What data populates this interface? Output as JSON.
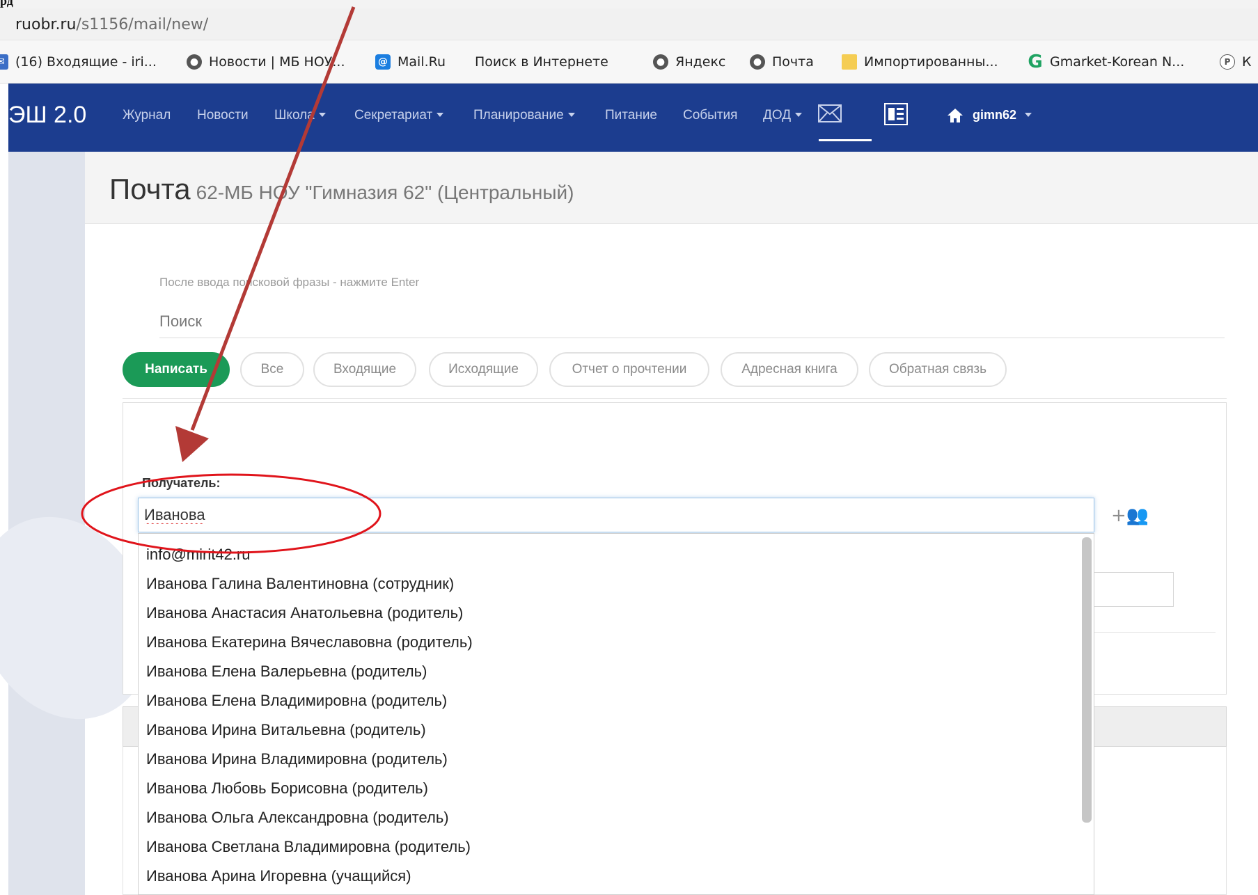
{
  "document": {
    "title_fragment": "рд"
  },
  "browser": {
    "url_host": "ruobr.ru",
    "url_path": "/s1156/mail/new/",
    "bookmarks": [
      {
        "label": "(16) Входящие - iri...",
        "icon": "mail-icon"
      },
      {
        "label": "Новости | МБ НОУ...",
        "icon": "globe-icon"
      },
      {
        "label": "Mail.Ru",
        "icon": "mail-ru-icon"
      },
      {
        "label": "Поиск в Интернете",
        "icon": "search-icon"
      },
      {
        "label": "Яндекс",
        "icon": "globe-icon"
      },
      {
        "label": "Почта",
        "icon": "globe-icon"
      },
      {
        "label": "Импортированны...",
        "icon": "folder-icon"
      },
      {
        "label": "Gmarket-Korean N...",
        "icon": "g-icon"
      },
      {
        "label": "К",
        "icon": "p-icon"
      }
    ]
  },
  "nav": {
    "brand": "ЭШ 2.0",
    "items": [
      {
        "label": "Журнал",
        "dropdown": false
      },
      {
        "label": "Новости",
        "dropdown": false
      },
      {
        "label": "Школа",
        "dropdown": true
      },
      {
        "label": "Секретариат",
        "dropdown": true
      },
      {
        "label": "Планирование",
        "dropdown": true
      },
      {
        "label": "Питание",
        "dropdown": false
      },
      {
        "label": "События",
        "dropdown": false
      },
      {
        "label": "ДОД",
        "dropdown": true
      }
    ],
    "user": "gimn62",
    "colors": {
      "background": "#1c3d8f",
      "text": "#c8d2ec"
    }
  },
  "page": {
    "title": "Почта",
    "subtitle": "62-МБ НОУ \"Гимназия 62\" (Центральный)"
  },
  "search": {
    "hint": "После ввода поисковой фразы - нажмите Enter",
    "placeholder": "Поиск"
  },
  "tabs": [
    {
      "label": "Написать",
      "primary": true
    },
    {
      "label": "Все",
      "primary": false
    },
    {
      "label": "Входящие",
      "primary": false
    },
    {
      "label": "Исходящие",
      "primary": false
    },
    {
      "label": "Отчет о прочтении",
      "primary": false
    },
    {
      "label": "Адресная книга",
      "primary": false
    },
    {
      "label": "Обратная связь",
      "primary": false
    }
  ],
  "compose": {
    "recipient_label": "Получатель:",
    "recipient_value": "Иванова",
    "add_recipient_icon": "add-contacts-icon",
    "accent_color": "#1b9a57"
  },
  "suggestions": [
    "info@mirit42.ru",
    "Иванова Галина Валентиновна (сотрудник)",
    "Иванова Анастасия Анатольевна (родитель)",
    "Иванова Екатерина Вячеславовна (родитель)",
    "Иванова Елена Валерьевна (родитель)",
    "Иванова Елена Владимировна (родитель)",
    "Иванова Ирина Витальевна (родитель)",
    "Иванова Ирина Владимировна (родитель)",
    "Иванова Любовь Борисовна (родитель)",
    "Иванова Ольга Александровна (родитель)",
    "Иванова Светлана Владимировна (родитель)",
    "Иванова Арина Игоревна (учащийся)"
  ],
  "annotations": {
    "arrow_color": "#b33a36",
    "highlight_color": "#e0141b"
  }
}
